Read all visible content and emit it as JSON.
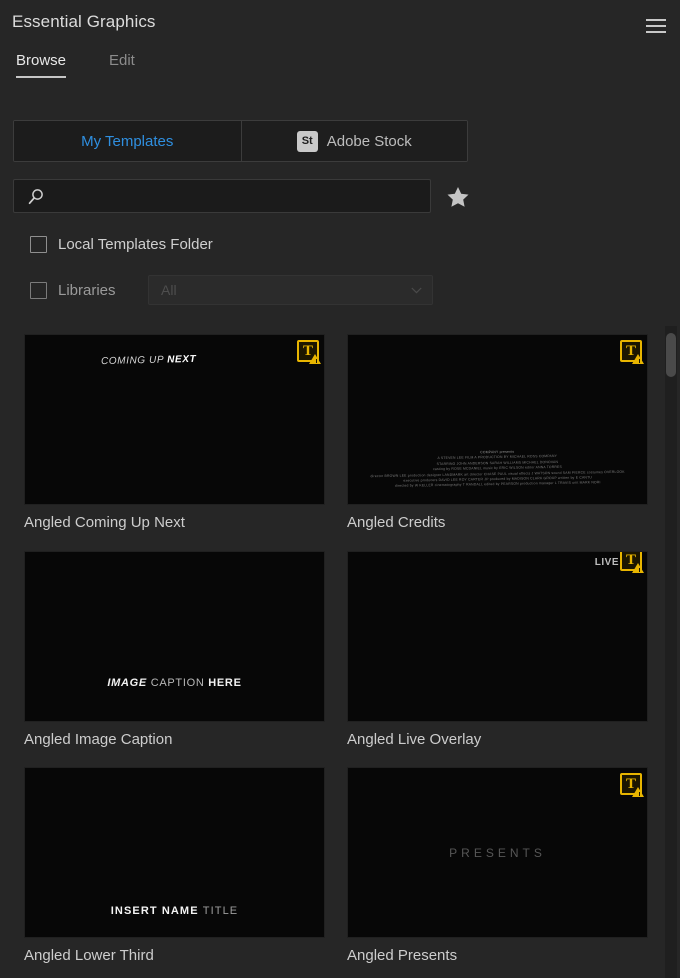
{
  "panel": {
    "title": "Essential Graphics",
    "menu_icon": "hamburger-menu-icon"
  },
  "tabs": [
    {
      "label": "Browse",
      "active": true
    },
    {
      "label": "Edit",
      "active": false
    }
  ],
  "source_toggle": {
    "my_templates_label": "My Templates",
    "adobe_stock_label": "Adobe Stock",
    "stock_icon_text": "St",
    "active": "My Templates",
    "active_color": "#2f8fe0"
  },
  "search": {
    "value": "",
    "placeholder": "",
    "icon": "search-icon",
    "favorites_icon": "star-icon"
  },
  "filters": {
    "local_templates": {
      "label": "Local Templates Folder",
      "checked": false
    },
    "libraries": {
      "label": "Libraries",
      "checked": false
    },
    "libraries_select": {
      "value": "All",
      "enabled": false
    }
  },
  "templates": [
    {
      "label": "Angled Coming Up Next",
      "has_font_warning": true,
      "art_kind": "coming-up-next",
      "art_text_light": "COMING UP ",
      "art_text_bold": "NEXT"
    },
    {
      "label": "Angled Credits",
      "has_font_warning": true,
      "art_kind": "credits",
      "credit_lines": [
        "COMPANY  presents",
        "A  STEVEN LEE FILM       A  PRODUCTION BY  MICHAEL ROSS COMPANY",
        "STARRING   JOHN ANDERSON   SARAH WILLIAMS   MICHAEL DONOVAN",
        "casting by  ROSE MCDANIEL  music by  ERIC WILSON  editor  ANNA TORRES",
        "director  BROWN LEE  production designer  LANDMARK  art director  CHASE PAUL  visual effects  J WATSON  sound  SAM PIERCE  costumes  OVERLOOK",
        "executive producers  DAVID LEE ROY  CARTER JP  produced by  MADISON CLARK GROUP  written by  E CANTU",
        "directed by  W KELLER  cinematography  T RANDALL  edited by  PEARSON   production manager  L TRAVIS  unit  MARK NORI"
      ]
    },
    {
      "label": "Angled Image Caption",
      "has_font_warning": false,
      "art_kind": "image-caption",
      "art_bold_1": "IMAGE ",
      "art_light": "CAPTION ",
      "art_bold_2": "HERE"
    },
    {
      "label": "Angled Live Overlay",
      "has_font_warning": true,
      "art_kind": "live-overlay",
      "art_text": "LIVE"
    },
    {
      "label": "Angled Lower Third",
      "has_font_warning": false,
      "art_kind": "lower-third",
      "art_bold": "INSERT NAME ",
      "art_light": "TITLE"
    },
    {
      "label": "Angled Presents",
      "has_font_warning": true,
      "art_kind": "presents",
      "art_text": "PRESENTS"
    }
  ],
  "scrollbar": {
    "orientation": "vertical",
    "position": "top"
  },
  "colors": {
    "panel_bg": "#262626",
    "thumb_bg": "#070707",
    "accent_blue": "#2f8fe0",
    "warning_yellow": "#e8b500",
    "text": "#d4d4d4"
  }
}
